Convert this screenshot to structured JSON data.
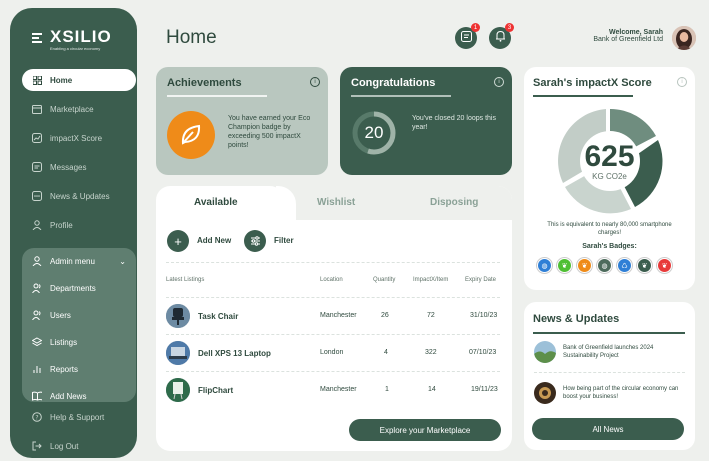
{
  "brand": {
    "name": "XSILIO",
    "tagline": "Enabling a circular economy"
  },
  "sidebar": {
    "items": [
      {
        "label": "Home",
        "icon": "grid-icon"
      },
      {
        "label": "Marketplace",
        "icon": "storefront-icon"
      },
      {
        "label": "impactX Score",
        "icon": "chart-icon"
      },
      {
        "label": "Messages",
        "icon": "message-icon"
      },
      {
        "label": "News & Updates",
        "icon": "news-icon"
      },
      {
        "label": "Profile",
        "icon": "user-icon"
      }
    ],
    "admin": {
      "label": "Admin menu",
      "items": [
        {
          "label": "Departments",
          "icon": "users-icon"
        },
        {
          "label": "Users",
          "icon": "users-icon"
        },
        {
          "label": "Listings",
          "icon": "layers-icon"
        },
        {
          "label": "Reports",
          "icon": "bar-chart-icon"
        },
        {
          "label": "Add News",
          "icon": "book-icon"
        }
      ]
    },
    "bottom": [
      {
        "label": "Help & Support",
        "icon": "help-icon"
      },
      {
        "label": "Log Out",
        "icon": "logout-icon"
      }
    ]
  },
  "header": {
    "title": "Home",
    "messages_count": "1",
    "notifications_count": "3",
    "welcome": "Welcome, Sarah",
    "org": "Bank of Greenfield Ltd"
  },
  "achievements": {
    "title": "Achievements",
    "text": "You have earned your Eco Champion badge by exceeding 500 impactX points!"
  },
  "congrats": {
    "title": "Congratulations",
    "count": "20",
    "text": "You've closed 20 loops this year!",
    "progress": 0.55
  },
  "listings": {
    "tabs": [
      "Available",
      "Wishlist",
      "Disposing"
    ],
    "add_label": "Add New",
    "filter_label": "Filter",
    "columns": [
      "Latest Listings",
      "Location",
      "Quantity",
      "ImpactX/Item",
      "Expiry Date"
    ],
    "rows": [
      {
        "name": "Task Chair",
        "location": "Manchester",
        "quantity": "26",
        "impact": "72",
        "expiry": "31/10/23"
      },
      {
        "name": "Dell XPS 13 Laptop",
        "location": "London",
        "quantity": "4",
        "impact": "322",
        "expiry": "07/10/23"
      },
      {
        "name": "FlipChart",
        "location": "Manchester",
        "quantity": "1",
        "impact": "14",
        "expiry": "19/11/23"
      }
    ],
    "explore_label": "Explore your Marketplace"
  },
  "score": {
    "title": "Sarah's impactX Score",
    "value": "625",
    "unit": "KG CO2e",
    "equivalent": "This is equivalent to nearly 80,000 smartphone charges!",
    "badges_title": "Sarah's Badges:",
    "badges": [
      {
        "color": "#2f7fd6"
      },
      {
        "color": "#4fbf34"
      },
      {
        "color": "#ef8b19"
      },
      {
        "color": "#4d6b5c"
      },
      {
        "color": "#2f7fd6"
      },
      {
        "color": "#3b5d4e"
      },
      {
        "color": "#e83a3a"
      }
    ]
  },
  "news": {
    "title": "News & Updates",
    "items": [
      {
        "text": "Bank of Greenfield launches 2024 Sustainability Project"
      },
      {
        "text": "How being part of the circular economy can boost your business!"
      }
    ],
    "all_label": "All News"
  }
}
